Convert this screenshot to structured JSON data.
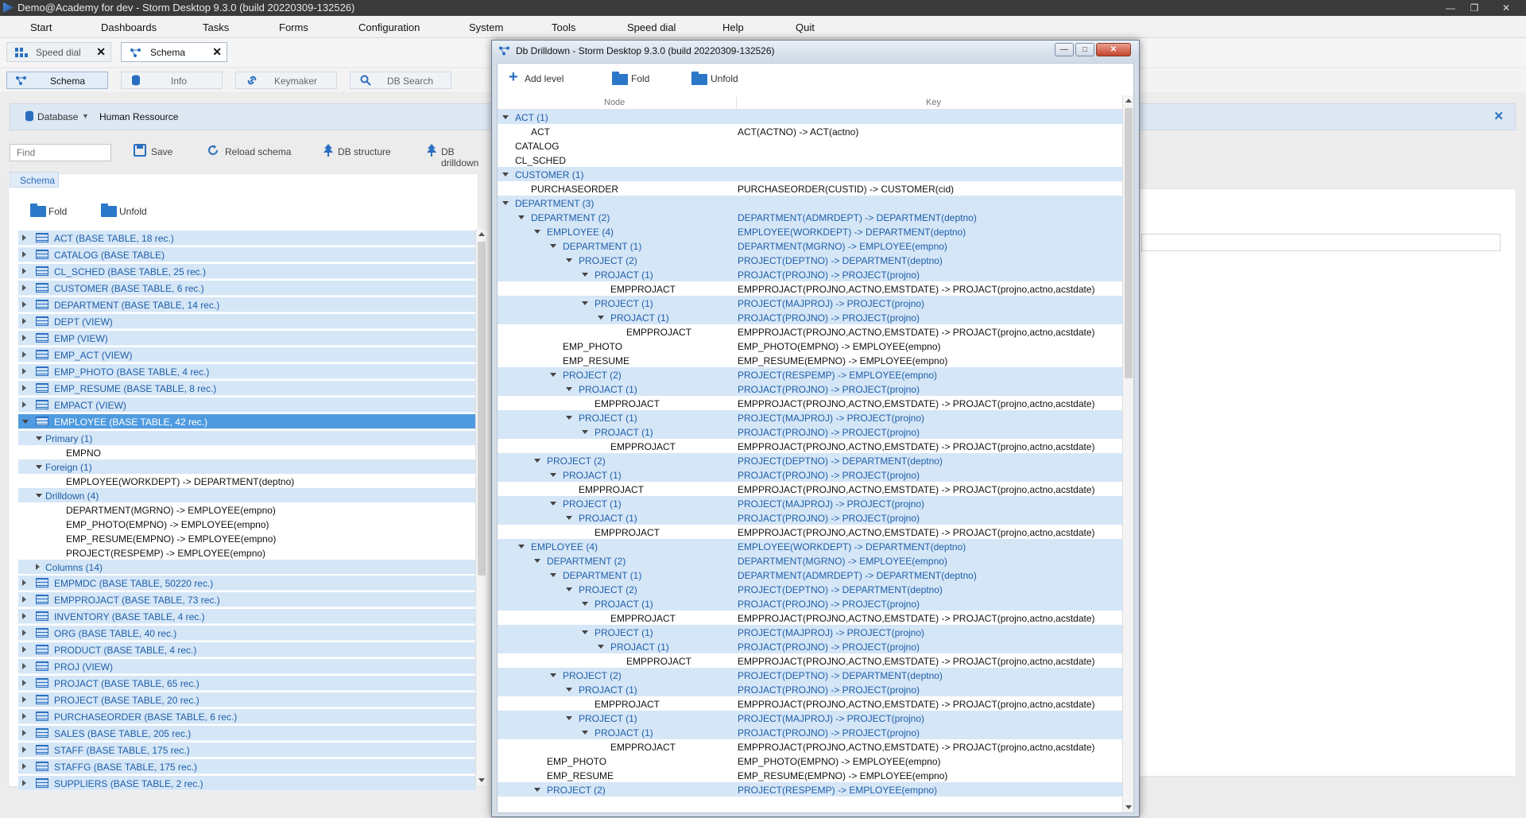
{
  "window": {
    "title": "Demo@Academy for dev -  Storm Desktop 9.3.0 (build 20220309-132526)"
  },
  "menu": [
    "Start",
    "Dashboards",
    "Tasks",
    "Forms",
    "Configuration",
    "System",
    "Tools",
    "Speed dial",
    "Help",
    "Quit"
  ],
  "doc_tabs": [
    {
      "label": "Speed dial"
    },
    {
      "label": "Schema"
    }
  ],
  "sub_tabs": [
    {
      "label": "Schema"
    },
    {
      "label": "Info"
    },
    {
      "label": "Keymaker"
    },
    {
      "label": "DB Search"
    }
  ],
  "db_bar": {
    "database_label": "Database",
    "value": "Human Ressource"
  },
  "toolbar": {
    "find_placeholder": "Find",
    "save": "Save",
    "reload": "Reload schema",
    "db_structure": "DB structure",
    "db_drilldown": "DB drilldown"
  },
  "schema_tab": "Schema",
  "fold": {
    "fold": "Fold",
    "unfold": "Unfold"
  },
  "tree_top": [
    "ACT (BASE TABLE, 18 rec.)",
    "CATALOG (BASE TABLE)",
    "CL_SCHED (BASE TABLE, 25 rec.)",
    "CUSTOMER (BASE TABLE, 6 rec.)",
    "DEPARTMENT (BASE TABLE, 14 rec.)",
    "DEPT (VIEW)",
    "EMP (VIEW)",
    "EMP_ACT (VIEW)",
    "EMP_PHOTO (BASE TABLE, 4 rec.)",
    "EMP_RESUME (BASE TABLE, 8 rec.)",
    "EMPACT (VIEW)"
  ],
  "tree_selected": "EMPLOYEE (BASE TABLE, 42 rec.)",
  "tree_sub": [
    {
      "t": "Primary (1)",
      "blue": true,
      "indent": 1,
      "arrow": "open"
    },
    {
      "t": "EMPNO",
      "blue": false,
      "indent": 2
    },
    {
      "t": "Foreign (1)",
      "blue": true,
      "indent": 1,
      "arrow": "open"
    },
    {
      "t": "EMPLOYEE(WORKDEPT) -> DEPARTMENT(deptno)",
      "blue": false,
      "indent": 2
    },
    {
      "t": "Drilldown (4)",
      "blue": true,
      "indent": 1,
      "arrow": "open"
    },
    {
      "t": "DEPARTMENT(MGRNO) -> EMPLOYEE(empno)",
      "blue": false,
      "indent": 2
    },
    {
      "t": "EMP_PHOTO(EMPNO) -> EMPLOYEE(empno)",
      "blue": false,
      "indent": 2
    },
    {
      "t": "EMP_RESUME(EMPNO) -> EMPLOYEE(empno)",
      "blue": false,
      "indent": 2
    },
    {
      "t": "PROJECT(RESPEMP) -> EMPLOYEE(empno)",
      "blue": false,
      "indent": 2
    },
    {
      "t": "Columns (14)",
      "blue": true,
      "indent": 1,
      "arrow": "closed"
    }
  ],
  "tree_bottom": [
    "EMPMDC (BASE TABLE, 50220 rec.)",
    "EMPPROJACT (BASE TABLE, 73 rec.)",
    "INVENTORY (BASE TABLE, 4 rec.)",
    "ORG (BASE TABLE, 40 rec.)",
    "PRODUCT (BASE TABLE, 4 rec.)",
    "PROJ (VIEW)",
    "PROJACT (BASE TABLE, 65 rec.)",
    "PROJECT (BASE TABLE, 20 rec.)",
    "PURCHASEORDER (BASE TABLE, 6 rec.)",
    "SALES (BASE TABLE, 205 rec.)",
    "STAFF (BASE TABLE, 175 rec.)",
    "STAFFG (BASE TABLE, 175 rec.)",
    "SUPPLIERS (BASE TABLE, 2 rec.)"
  ],
  "dialog": {
    "title": "Db Drilldown -  Storm Desktop 9.3.0 (build 20220309-132526)",
    "add_level": "Add level",
    "fold": "Fold",
    "unfold": "Unfold",
    "col_node": "Node",
    "col_key": "Key",
    "rows": [
      {
        "n": "ACT (1)",
        "k": "",
        "l": 0,
        "b": true
      },
      {
        "n": "ACT",
        "k": "ACT(ACTNO) -> ACT(actno)",
        "l": 1,
        "b": false
      },
      {
        "n": "CATALOG",
        "k": "",
        "l": 0,
        "b": false
      },
      {
        "n": "CL_SCHED",
        "k": "",
        "l": 0,
        "b": false
      },
      {
        "n": "CUSTOMER (1)",
        "k": "",
        "l": 0,
        "b": true
      },
      {
        "n": "PURCHASEORDER",
        "k": "PURCHASEORDER(CUSTID) -> CUSTOMER(cid)",
        "l": 1,
        "b": false
      },
      {
        "n": "DEPARTMENT (3)",
        "k": "",
        "l": 0,
        "b": true
      },
      {
        "n": "DEPARTMENT (2)",
        "k": "DEPARTMENT(ADMRDEPT) -> DEPARTMENT(deptno)",
        "l": 1,
        "b": true
      },
      {
        "n": "EMPLOYEE (4)",
        "k": "EMPLOYEE(WORKDEPT) -> DEPARTMENT(deptno)",
        "l": 2,
        "b": true
      },
      {
        "n": "DEPARTMENT (1)",
        "k": "DEPARTMENT(MGRNO) -> EMPLOYEE(empno)",
        "l": 3,
        "b": true
      },
      {
        "n": "PROJECT (2)",
        "k": "PROJECT(DEPTNO) -> DEPARTMENT(deptno)",
        "l": 4,
        "b": true
      },
      {
        "n": "PROJACT (1)",
        "k": "PROJACT(PROJNO) -> PROJECT(projno)",
        "l": 5,
        "b": true
      },
      {
        "n": "EMPPROJACT",
        "k": "EMPPROJACT(PROJNO,ACTNO,EMSTDATE) -> PROJACT(projno,actno,acstdate)",
        "l": 6,
        "b": false
      },
      {
        "n": "PROJECT (1)",
        "k": "PROJECT(MAJPROJ) -> PROJECT(projno)",
        "l": 5,
        "b": true
      },
      {
        "n": "PROJACT (1)",
        "k": "PROJACT(PROJNO) -> PROJECT(projno)",
        "l": 6,
        "b": true
      },
      {
        "n": "EMPPROJACT",
        "k": "EMPPROJACT(PROJNO,ACTNO,EMSTDATE) -> PROJACT(projno,actno,acstdate)",
        "l": 7,
        "b": false
      },
      {
        "n": "EMP_PHOTO",
        "k": "EMP_PHOTO(EMPNO) -> EMPLOYEE(empno)",
        "l": 3,
        "b": false
      },
      {
        "n": "EMP_RESUME",
        "k": "EMP_RESUME(EMPNO) -> EMPLOYEE(empno)",
        "l": 3,
        "b": false
      },
      {
        "n": "PROJECT (2)",
        "k": "PROJECT(RESPEMP) -> EMPLOYEE(empno)",
        "l": 3,
        "b": true
      },
      {
        "n": "PROJACT (1)",
        "k": "PROJACT(PROJNO) -> PROJECT(projno)",
        "l": 4,
        "b": true
      },
      {
        "n": "EMPPROJACT",
        "k": "EMPPROJACT(PROJNO,ACTNO,EMSTDATE) -> PROJACT(projno,actno,acstdate)",
        "l": 5,
        "b": false
      },
      {
        "n": "PROJECT (1)",
        "k": "PROJECT(MAJPROJ) -> PROJECT(projno)",
        "l": 4,
        "b": true
      },
      {
        "n": "PROJACT (1)",
        "k": "PROJACT(PROJNO) -> PROJECT(projno)",
        "l": 5,
        "b": true
      },
      {
        "n": "EMPPROJACT",
        "k": "EMPPROJACT(PROJNO,ACTNO,EMSTDATE) -> PROJACT(projno,actno,acstdate)",
        "l": 6,
        "b": false
      },
      {
        "n": "PROJECT (2)",
        "k": "PROJECT(DEPTNO) -> DEPARTMENT(deptno)",
        "l": 2,
        "b": true
      },
      {
        "n": "PROJACT (1)",
        "k": "PROJACT(PROJNO) -> PROJECT(projno)",
        "l": 3,
        "b": true
      },
      {
        "n": "EMPPROJACT",
        "k": "EMPPROJACT(PROJNO,ACTNO,EMSTDATE) -> PROJACT(projno,actno,acstdate)",
        "l": 4,
        "b": false
      },
      {
        "n": "PROJECT (1)",
        "k": "PROJECT(MAJPROJ) -> PROJECT(projno)",
        "l": 3,
        "b": true
      },
      {
        "n": "PROJACT (1)",
        "k": "PROJACT(PROJNO) -> PROJECT(projno)",
        "l": 4,
        "b": true
      },
      {
        "n": "EMPPROJACT",
        "k": "EMPPROJACT(PROJNO,ACTNO,EMSTDATE) -> PROJACT(projno,actno,acstdate)",
        "l": 5,
        "b": false
      },
      {
        "n": "EMPLOYEE (4)",
        "k": "EMPLOYEE(WORKDEPT) -> DEPARTMENT(deptno)",
        "l": 1,
        "b": true
      },
      {
        "n": "DEPARTMENT (2)",
        "k": "DEPARTMENT(MGRNO) -> EMPLOYEE(empno)",
        "l": 2,
        "b": true
      },
      {
        "n": "DEPARTMENT (1)",
        "k": "DEPARTMENT(ADMRDEPT) -> DEPARTMENT(deptno)",
        "l": 3,
        "b": true
      },
      {
        "n": "PROJECT (2)",
        "k": "PROJECT(DEPTNO) -> DEPARTMENT(deptno)",
        "l": 4,
        "b": true
      },
      {
        "n": "PROJACT (1)",
        "k": "PROJACT(PROJNO) -> PROJECT(projno)",
        "l": 5,
        "b": true
      },
      {
        "n": "EMPPROJACT",
        "k": "EMPPROJACT(PROJNO,ACTNO,EMSTDATE) -> PROJACT(projno,actno,acstdate)",
        "l": 6,
        "b": false
      },
      {
        "n": "PROJECT (1)",
        "k": "PROJECT(MAJPROJ) -> PROJECT(projno)",
        "l": 5,
        "b": true
      },
      {
        "n": "PROJACT (1)",
        "k": "PROJACT(PROJNO) -> PROJECT(projno)",
        "l": 6,
        "b": true
      },
      {
        "n": "EMPPROJACT",
        "k": "EMPPROJACT(PROJNO,ACTNO,EMSTDATE) -> PROJACT(projno,actno,acstdate)",
        "l": 7,
        "b": false
      },
      {
        "n": "PROJECT (2)",
        "k": "PROJECT(DEPTNO) -> DEPARTMENT(deptno)",
        "l": 3,
        "b": true
      },
      {
        "n": "PROJACT (1)",
        "k": "PROJACT(PROJNO) -> PROJECT(projno)",
        "l": 4,
        "b": true
      },
      {
        "n": "EMPPROJACT",
        "k": "EMPPROJACT(PROJNO,ACTNO,EMSTDATE) -> PROJACT(projno,actno,acstdate)",
        "l": 5,
        "b": false
      },
      {
        "n": "PROJECT (1)",
        "k": "PROJECT(MAJPROJ) -> PROJECT(projno)",
        "l": 4,
        "b": true
      },
      {
        "n": "PROJACT (1)",
        "k": "PROJACT(PROJNO) -> PROJECT(projno)",
        "l": 5,
        "b": true
      },
      {
        "n": "EMPPROJACT",
        "k": "EMPPROJACT(PROJNO,ACTNO,EMSTDATE) -> PROJACT(projno,actno,acstdate)",
        "l": 6,
        "b": false
      },
      {
        "n": "EMP_PHOTO",
        "k": "EMP_PHOTO(EMPNO) -> EMPLOYEE(empno)",
        "l": 2,
        "b": false
      },
      {
        "n": "EMP_RESUME",
        "k": "EMP_RESUME(EMPNO) -> EMPLOYEE(empno)",
        "l": 2,
        "b": false
      },
      {
        "n": "PROJECT (2)",
        "k": "PROJECT(RESPEMP) -> EMPLOYEE(empno)",
        "l": 2,
        "b": true
      }
    ]
  },
  "colors": {
    "tree_blue": "#d5e6f7",
    "text_blue": "#1f5fa8",
    "selected": "#4f9be0"
  }
}
